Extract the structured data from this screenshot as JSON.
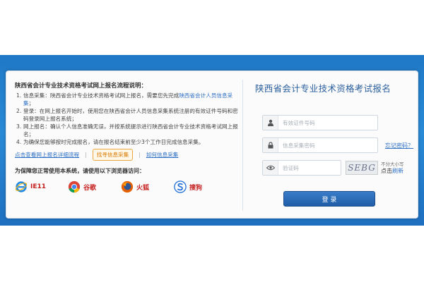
{
  "notice": {
    "title": "陕西省会计专业技术资格考试网上报名流程说明：",
    "steps": [
      {
        "num": "1.",
        "text": "信息采集：陕西省会计专业技术资格考试网上报名，需要您先完成",
        "link": "陕西省会计人员信息采集",
        "suffix": "；"
      },
      {
        "num": "2.",
        "text": "登录：在网上报名开始时，使用您在陕西省会计人员信息采集系统注册的有效证件号码和密码登录网上报名系统；"
      },
      {
        "num": "3.",
        "text": "网上报名：确认个人信息准确无误，并按系统提示进行陕西省会计专业技术资格考试网上报名；"
      },
      {
        "num": "4.",
        "text": "为确保您能够按时完成报名，请在报名结束前至少3个工作日完成信息采集。"
      }
    ],
    "links": {
      "flow_detail": "点击查看网上报名详细流程",
      "find_info": "找寻信息采集",
      "how_collect": "如何信息采集",
      "separator": "|"
    }
  },
  "browsers": {
    "title": "为保障您正常使用本系统，请使用以下浏览器访问：",
    "items": [
      {
        "name": "IE11",
        "icon": "ie-icon"
      },
      {
        "name": "谷歌",
        "icon": "chrome-icon"
      },
      {
        "name": "火狐",
        "icon": "firefox-icon"
      },
      {
        "name": "搜狗",
        "icon": "sogou-icon"
      }
    ]
  },
  "login": {
    "title": "陕西省会计专业技术资格考试报名",
    "id_placeholder": "有效证件号码",
    "password_placeholder": "信息采集密码",
    "captcha_placeholder": "验证码",
    "forgot_label": "忘记密码？",
    "captcha_text": "SEBG",
    "refresh_hint": "不分大小写",
    "refresh_prefix": "点击",
    "refresh_label": "刷新",
    "submit_label": "登 录"
  },
  "colors": {
    "banner": "#2a8ad6",
    "link": "#2c6fc4",
    "button": "#1f5ea8",
    "browser_label": "#c51e1e"
  }
}
